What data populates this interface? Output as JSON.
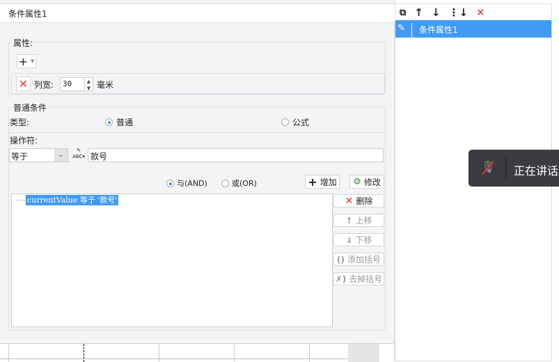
{
  "title": "条件属性1",
  "props": {
    "legend": "属性:",
    "add_icon": "plus-dropdown-icon",
    "col_width_label": "列宽:",
    "col_width_value": "30",
    "unit": "毫米"
  },
  "cond": {
    "legend": "普通条件",
    "type_label": "类型:",
    "type_normal": "普通",
    "type_formula": "公式",
    "operator_label": "操作符:",
    "operator_value": "等于",
    "value": "款号"
  },
  "logic": {
    "and": "与(AND)",
    "or": "或(OR)",
    "add": "增加",
    "modify": "修改"
  },
  "list": {
    "items": [
      "currentValue 等于 '款号'"
    ]
  },
  "side_buttons": {
    "delete": "删除",
    "up": "上移",
    "down": "下移",
    "add_bracket": "添加括号",
    "remove_bracket": "去掉括号"
  },
  "right": {
    "items": [
      "条件属性1"
    ]
  },
  "toast": {
    "text": "正在讲话"
  },
  "colors": {
    "selection": "#3f9af5",
    "danger": "#e53935"
  }
}
